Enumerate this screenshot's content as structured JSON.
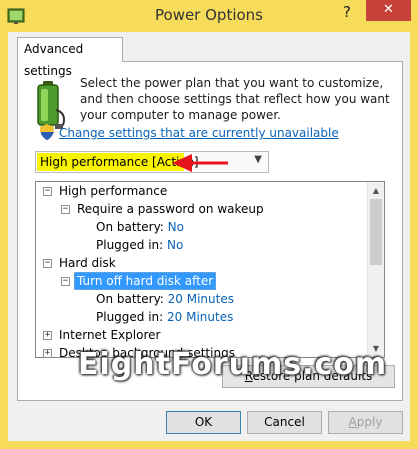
{
  "window": {
    "title": "Power Options",
    "help_label": "?",
    "close_label": "✕"
  },
  "tab": {
    "label": "Advanced settings"
  },
  "description": "Select the power plan that you want to customize, and then choose settings that reflect how you want your computer to manage power.",
  "change_settings_link": "Change settings that are currently unavailable",
  "plan_select": {
    "selected": "High performance [Active]"
  },
  "tree": {
    "items": [
      {
        "label": "High performance",
        "expander": "−"
      },
      {
        "label": "Require a password on wakeup",
        "expander": "−"
      },
      {
        "key": "On battery:",
        "value": "No"
      },
      {
        "key": "Plugged in:",
        "value": "No"
      },
      {
        "label": "Hard disk",
        "expander": "−"
      },
      {
        "label": "Turn off hard disk after",
        "expander": "−"
      },
      {
        "key": "On battery:",
        "value": "20 Minutes"
      },
      {
        "key": "Plugged in:",
        "value": "20 Minutes"
      },
      {
        "label": "Internet Explorer",
        "expander": "+"
      },
      {
        "label": "Desktop background settings",
        "expander": "+"
      }
    ]
  },
  "buttons": {
    "restore_first": "R",
    "restore_rest": "estore plan defaults",
    "ok": "OK",
    "cancel": "Cancel",
    "apply_first": "A",
    "apply_rest": "pply"
  },
  "watermark": "EightForums.com",
  "colors": {
    "title_bar": "#f6dc5a",
    "close_button": "#c7433a",
    "link": "#0b62b5",
    "highlight": "#f8f400",
    "selection": "#3399ff",
    "arrow": "#e8141b"
  }
}
